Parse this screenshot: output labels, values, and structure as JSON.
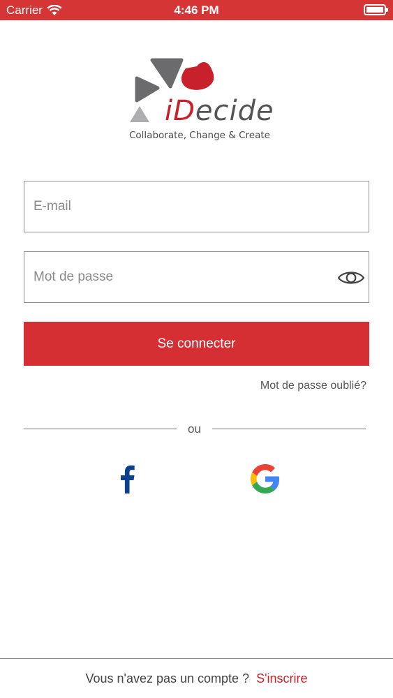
{
  "status_bar": {
    "carrier": "Carrier",
    "time": "4:46 PM"
  },
  "logo": {
    "word_accent": "iD",
    "word_rest": "ecide",
    "tagline": "Collaborate, Change & Create"
  },
  "form": {
    "email_placeholder": "E-mail",
    "password_placeholder": "Mot de passe",
    "login_label": "Se connecter",
    "forgot_label": "Mot de passe oublié?"
  },
  "divider_text": "ou",
  "social": {
    "facebook_icon": "facebook-icon",
    "google_icon": "google-icon"
  },
  "footer": {
    "question": "Vous n'avez pas un compte ?",
    "signup_label": "S'inscrire"
  },
  "colors": {
    "brand_red": "#d62f33",
    "status_bar": "#d63535",
    "logo_grey": "#6b6b6e"
  }
}
